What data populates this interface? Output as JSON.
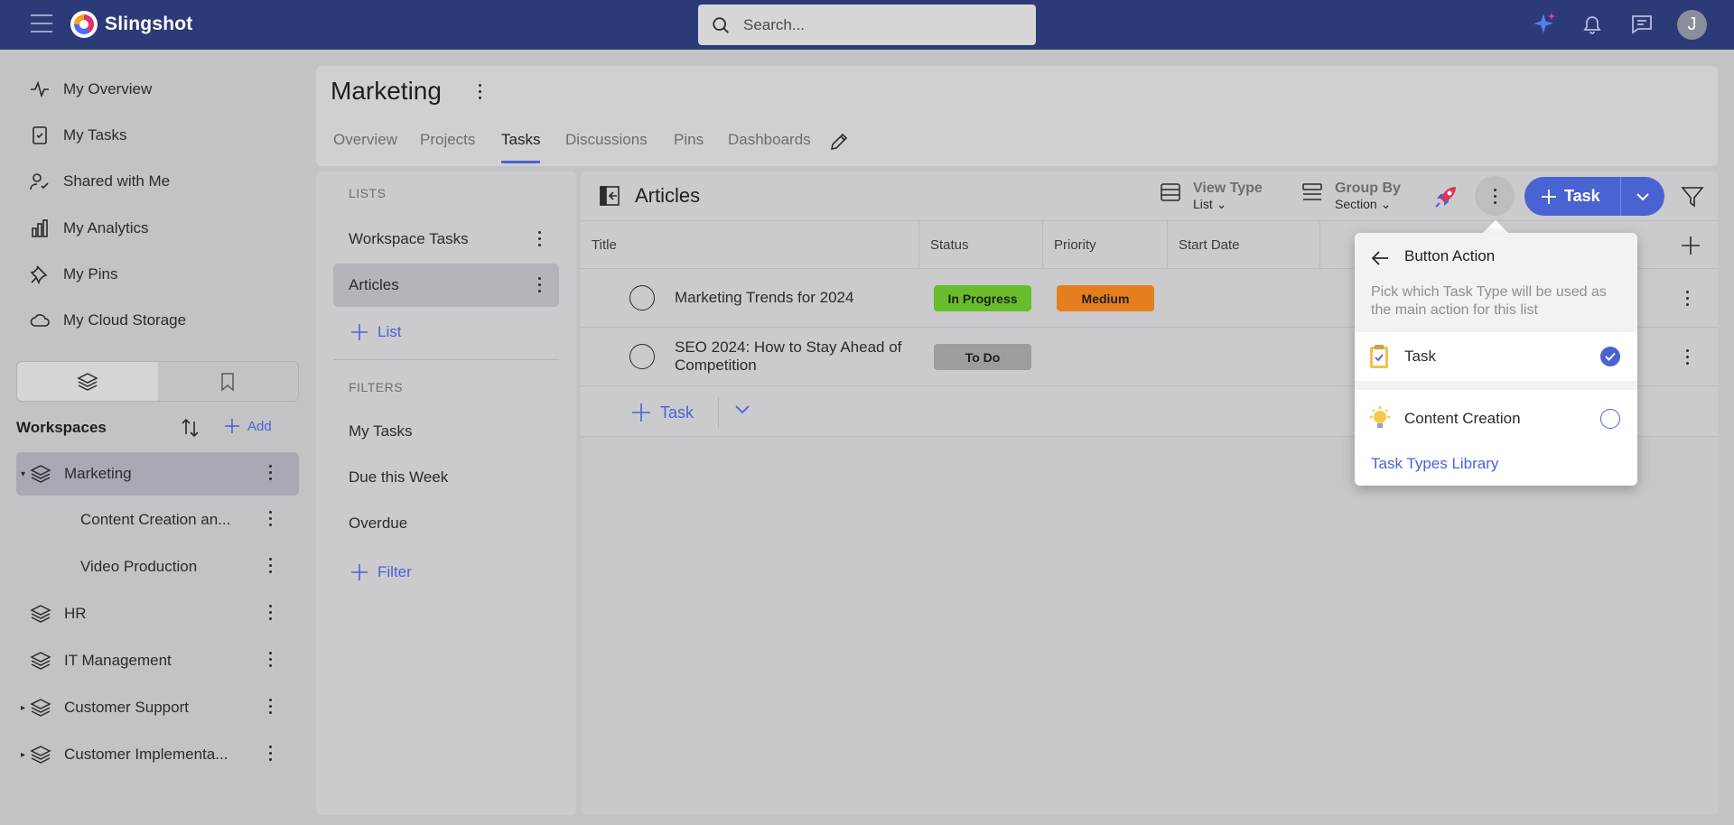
{
  "app": {
    "brand": "Slingshot",
    "search_placeholder": "Search...",
    "avatar_initial": "J"
  },
  "sidebar": {
    "nav": [
      {
        "label": "My Overview",
        "icon": "activity-icon"
      },
      {
        "label": "My Tasks",
        "icon": "clipboard-check-icon"
      },
      {
        "label": "Shared with Me",
        "icon": "user-check-icon"
      },
      {
        "label": "My Analytics",
        "icon": "bar-chart-icon"
      },
      {
        "label": "My Pins",
        "icon": "pin-icon"
      },
      {
        "label": "My Cloud Storage",
        "icon": "cloud-icon"
      }
    ],
    "workspaces_title": "Workspaces",
    "add_label": "Add",
    "workspaces": [
      {
        "label": "Marketing",
        "expanded": true,
        "active": true
      },
      {
        "label": "Content Creation an...",
        "sub": true
      },
      {
        "label": "Video Production",
        "sub": true
      },
      {
        "label": "HR"
      },
      {
        "label": "IT Management"
      },
      {
        "label": "Customer Support",
        "collapsed_children": true
      },
      {
        "label": "Customer Implementa...",
        "collapsed_children": true
      }
    ]
  },
  "header": {
    "title": "Marketing",
    "tabs": [
      "Overview",
      "Projects",
      "Tasks",
      "Discussions",
      "Pins",
      "Dashboards"
    ],
    "active_tab": "Tasks"
  },
  "lists_panel": {
    "lists_label": "LISTS",
    "lists": [
      "Workspace Tasks",
      "Articles"
    ],
    "active_list": "Articles",
    "add_list_label": "List",
    "filters_label": "FILTERS",
    "filters": [
      "My Tasks",
      "Due this Week",
      "Overdue"
    ],
    "add_filter_label": "Filter"
  },
  "content": {
    "title": "Articles",
    "view_type_label": "View Type",
    "view_type_value": "List",
    "group_by_label": "Group By",
    "group_by_value": "Section",
    "task_button_label": "Task",
    "columns": [
      "Title",
      "Status",
      "Priority",
      "Start Date"
    ],
    "rows": [
      {
        "title": "Marketing Trends for 2024",
        "status": "In Progress",
        "status_color": "#6abd2a",
        "priority": "Medium",
        "priority_color": "#e57e1f"
      },
      {
        "title": "SEO 2024: How to Stay Ahead of Competition",
        "status": "To Do",
        "status_color": "#9d9da1",
        "priority": ""
      }
    ],
    "add_task_label": "Task"
  },
  "popup": {
    "title": "Button Action",
    "description": "Pick which Task Type will be used as the main action for this list",
    "options": [
      {
        "label": "Task",
        "icon": "clipboard-icon",
        "selected": true
      },
      {
        "label": "Content Creation",
        "icon": "lightbulb-icon",
        "selected": false
      }
    ],
    "link": "Task Types Library"
  },
  "colors": {
    "topbar": "#2c3b78",
    "accent": "#4a63d3"
  }
}
